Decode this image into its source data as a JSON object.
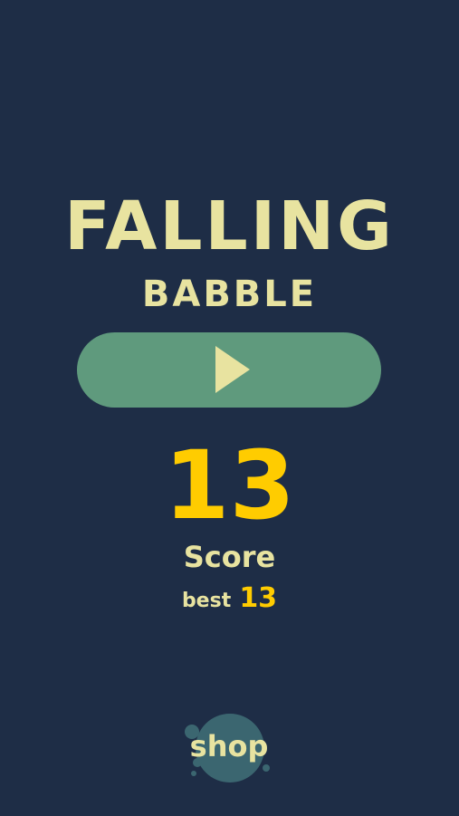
{
  "app": {
    "title_main": "FALLING",
    "title_sub": "BABBLE"
  },
  "play_button": {
    "icon": "play-icon"
  },
  "score": {
    "value": "13",
    "label": "Score",
    "best_label": "best",
    "best_value": "13"
  },
  "shop": {
    "label": "shop",
    "icon": "paint-blob"
  },
  "colors": {
    "background": "#1e2d46",
    "title_text": "#e8e3a0",
    "play_button": "#5f9a7d",
    "score_highlight": "#ffcc00",
    "shop_blob": "#3b6670"
  }
}
